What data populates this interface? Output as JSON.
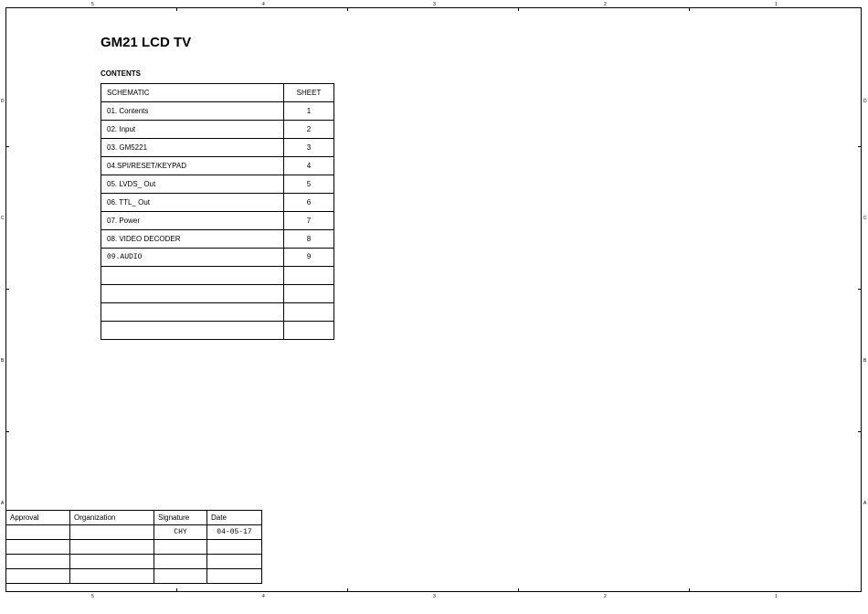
{
  "title": "GM21 LCD TV",
  "contents_label": "CONTENTS",
  "schematic_table": {
    "headers": {
      "name": "SCHEMATIC",
      "sheet": "SHEET"
    },
    "rows": [
      {
        "name": "01. Contents",
        "sheet": "1"
      },
      {
        "name": "02. Input",
        "sheet": "2"
      },
      {
        "name": "03. GM5221",
        "sheet": "3"
      },
      {
        "name": "04.SPI/RESET/KEYPAD",
        "sheet": "4"
      },
      {
        "name": "05. LVDS_ Out",
        "sheet": "5"
      },
      {
        "name": "06. TTL_ Out",
        "sheet": "6"
      },
      {
        "name": "07. Power",
        "sheet": "7"
      },
      {
        "name": "08. VIDEO DECODER",
        "sheet": "8"
      },
      {
        "name": "09.AUDIO",
        "sheet": "9"
      },
      {
        "name": "",
        "sheet": ""
      },
      {
        "name": "",
        "sheet": ""
      },
      {
        "name": "",
        "sheet": ""
      },
      {
        "name": "",
        "sheet": ""
      }
    ]
  },
  "signoff_table": {
    "headers": {
      "approval": "Approval",
      "organization": "Organization",
      "signature": "Signature",
      "date": "Date"
    },
    "rows": [
      {
        "approval": "",
        "organization": "",
        "signature": "CHY",
        "date": "04-05-17"
      },
      {
        "approval": "",
        "organization": "",
        "signature": "",
        "date": ""
      },
      {
        "approval": "",
        "organization": "",
        "signature": "",
        "date": ""
      },
      {
        "approval": "",
        "organization": "",
        "signature": "",
        "date": ""
      }
    ]
  },
  "ruler": {
    "top_numbers": [
      "5",
      "4",
      "3",
      "2",
      "1"
    ],
    "side_letters": [
      "D",
      "C",
      "B",
      "A"
    ]
  }
}
